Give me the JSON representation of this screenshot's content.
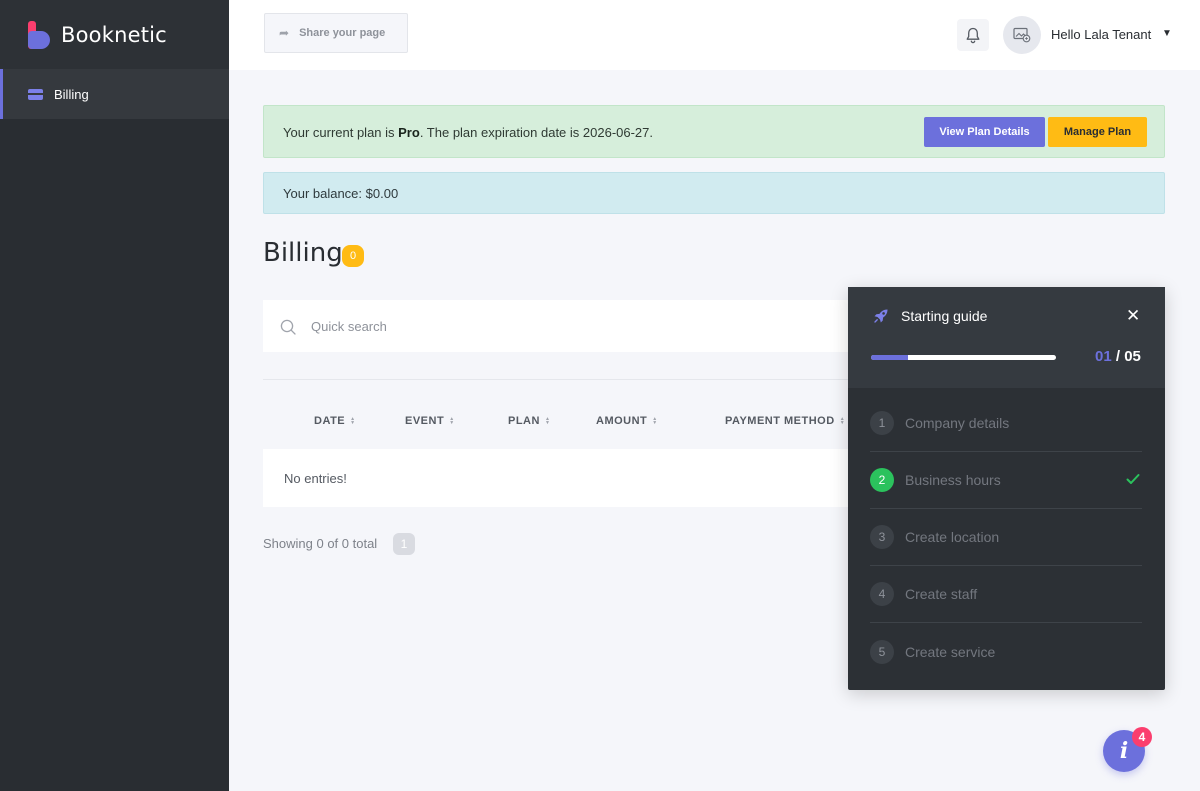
{
  "brand": {
    "name": "Booknetic",
    "colors": {
      "primary": "#6c70dc",
      "accent": "#fb3e6e",
      "warning": "#ffbb14",
      "success": "#2bc25d"
    }
  },
  "sidebar": {
    "items": [
      {
        "label": "Billing",
        "icon": "credit-card-icon",
        "active": true
      }
    ]
  },
  "header": {
    "share_label": "Share your page",
    "greeting": "Hello Lala Tenant",
    "icons": {
      "share": "share-arrow-icon",
      "notifications": "bell-icon",
      "avatar": "user-avatar-icon",
      "menu": "chevron-down-icon"
    }
  },
  "plan_alert": {
    "prefix": "Your current plan is ",
    "plan": "Pro",
    "suffix": ". The plan expiration date is 2026-06-27.",
    "view_label": "View Plan Details",
    "manage_label": "Manage Plan"
  },
  "balance": {
    "text": "Your balance: $0.00"
  },
  "page": {
    "title": "Billing",
    "count": "0"
  },
  "search": {
    "placeholder": "Quick search",
    "value": ""
  },
  "table": {
    "columns": [
      "DATE",
      "EVENT",
      "PLAN",
      "AMOUNT",
      "PAYMENT METHOD"
    ],
    "empty_text": "No entries!"
  },
  "pagination": {
    "showing": "Showing 0 of 0 total",
    "current_page": "1"
  },
  "guide": {
    "title": "Starting guide",
    "close_glyph": "✕",
    "current": "01",
    "separator": " / ",
    "total": "05",
    "progress": 0.2,
    "steps": [
      {
        "num": "1",
        "label": "Company details",
        "done": false
      },
      {
        "num": "2",
        "label": "Business hours",
        "done": true
      },
      {
        "num": "3",
        "label": "Create location",
        "done": false
      },
      {
        "num": "4",
        "label": "Create staff",
        "done": false
      },
      {
        "num": "5",
        "label": "Create service",
        "done": false
      }
    ]
  },
  "help": {
    "glyph": "i",
    "badge": "4"
  }
}
